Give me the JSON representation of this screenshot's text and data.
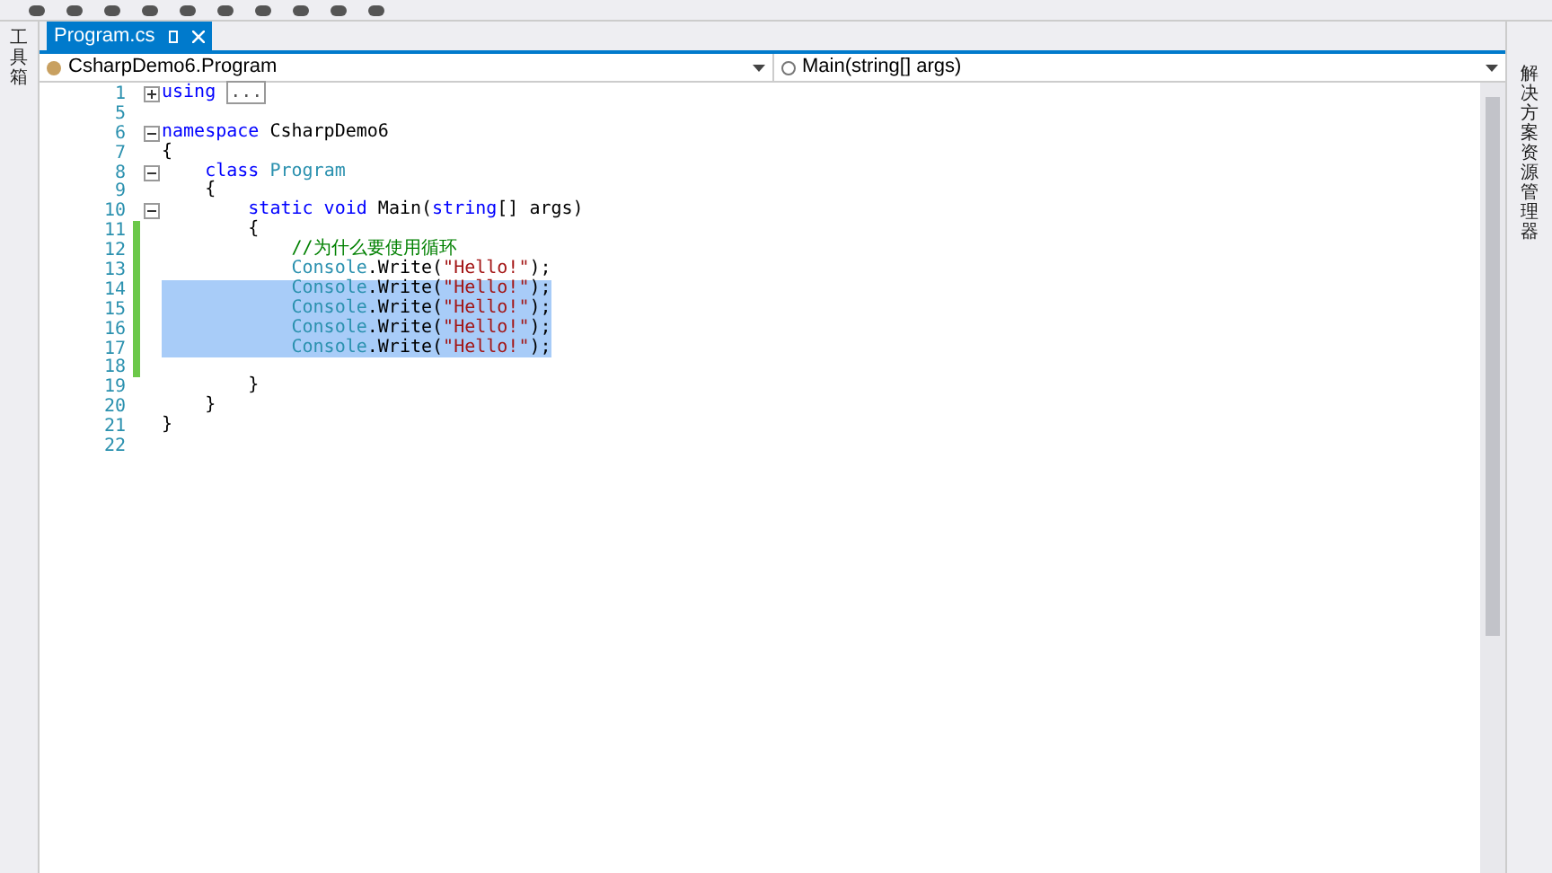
{
  "toolbox": {
    "label": "工具箱"
  },
  "tabs": [
    {
      "label": "Program.cs",
      "selected": true
    }
  ],
  "nav": {
    "class_dropdown": "CsharpDemo6.Program",
    "member_dropdown": "Main(string[] args)"
  },
  "code_lines": [
    {
      "number": "1",
      "collapsed": true,
      "changed": false,
      "selected": false,
      "tokens": [
        {
          "kind": "keyword",
          "text": "using "
        },
        {
          "kind": "collapsed",
          "text": "..."
        }
      ]
    },
    {
      "number": "5",
      "changed": false,
      "selected": false
    },
    {
      "number": "6",
      "collapsed": false,
      "changed": false,
      "selected": false,
      "tokens": [
        {
          "kind": "keyword",
          "text": "namespace"
        },
        {
          "kind": "plain",
          "text": " CsharpDemo6"
        }
      ]
    },
    {
      "number": "7",
      "changed": false,
      "selected": false,
      "tokens": [
        {
          "kind": "plain",
          "text": "{"
        }
      ]
    },
    {
      "number": "8",
      "collapsed": false,
      "changed": false,
      "selected": false,
      "tokens": [
        {
          "kind": "keyword",
          "text": "    class "
        },
        {
          "kind": "type",
          "text": "Program"
        }
      ]
    },
    {
      "number": "9",
      "changed": false,
      "selected": false,
      "tokens": [
        {
          "kind": "plain",
          "text": "    {"
        }
      ]
    },
    {
      "number": "10",
      "collapsed": false,
      "changed": false,
      "selected": false,
      "tokens": [
        {
          "kind": "keyword",
          "text": "        static void "
        },
        {
          "kind": "plain",
          "text": "Main("
        },
        {
          "kind": "keyword",
          "text": "string"
        },
        {
          "kind": "plain",
          "text": "[] args)"
        }
      ]
    },
    {
      "number": "11",
      "changed": true,
      "selected": false,
      "tokens": [
        {
          "kind": "plain",
          "text": "        {"
        }
      ]
    },
    {
      "number": "12",
      "changed": true,
      "selected": false,
      "tokens": [
        {
          "kind": "comment",
          "text": "            //为什么要使用循环"
        }
      ]
    },
    {
      "number": "13",
      "changed": true,
      "selected": false,
      "tokens": [
        {
          "kind": "type",
          "text": "            Console"
        },
        {
          "kind": "plain",
          "text": ".Write("
        },
        {
          "kind": "string",
          "text": "\"Hello!\""
        },
        {
          "kind": "plain",
          "text": ");"
        }
      ]
    },
    {
      "number": "14",
      "changed": true,
      "selected": true,
      "tokens": [
        {
          "kind": "type",
          "text": "            Console"
        },
        {
          "kind": "plain",
          "text": ".Write("
        },
        {
          "kind": "string",
          "text": "\"Hello!\""
        },
        {
          "kind": "plain",
          "text": ");"
        }
      ]
    },
    {
      "number": "15",
      "changed": true,
      "selected": true,
      "tokens": [
        {
          "kind": "type",
          "text": "            Console"
        },
        {
          "kind": "plain",
          "text": ".Write("
        },
        {
          "kind": "string",
          "text": "\"Hello!\""
        },
        {
          "kind": "plain",
          "text": ");"
        }
      ]
    },
    {
      "number": "16",
      "changed": true,
      "selected": true,
      "tokens": [
        {
          "kind": "type",
          "text": "            Console"
        },
        {
          "kind": "plain",
          "text": ".Write("
        },
        {
          "kind": "string",
          "text": "\"Hello!\""
        },
        {
          "kind": "plain",
          "text": ");"
        }
      ]
    },
    {
      "number": "17",
      "changed": true,
      "selected": true,
      "tokens": [
        {
          "kind": "type",
          "text": "            Console"
        },
        {
          "kind": "plain",
          "text": ".Write("
        },
        {
          "kind": "string",
          "text": "\"Hello!\""
        },
        {
          "kind": "plain",
          "text": ");"
        }
      ]
    },
    {
      "number": "18",
      "changed": true,
      "selected": false
    },
    {
      "number": "19",
      "changed": false,
      "selected": false,
      "tokens": [
        {
          "kind": "plain",
          "text": "        }"
        }
      ]
    },
    {
      "number": "20",
      "changed": false,
      "selected": false,
      "tokens": [
        {
          "kind": "plain",
          "text": "    }"
        }
      ]
    },
    {
      "number": "21",
      "changed": false,
      "selected": false,
      "tokens": [
        {
          "kind": "plain",
          "text": "}"
        }
      ]
    },
    {
      "number": "22",
      "changed": false,
      "selected": false
    }
  ],
  "solution_explorer": {
    "label": "解决方案资源管理器"
  }
}
